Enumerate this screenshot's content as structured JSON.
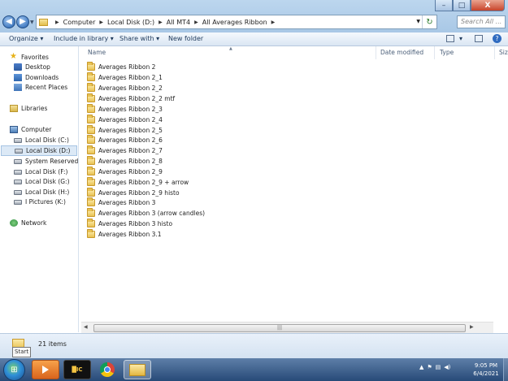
{
  "window": {
    "controls": {
      "minimize": "–",
      "maximize": "□",
      "close": "X"
    }
  },
  "nav": {
    "back_glyph": "◀",
    "forward_glyph": "▶",
    "dropdown_glyph": "▼"
  },
  "address": {
    "segments": [
      "Computer",
      "Local Disk (D:)",
      "All MT4",
      "All  Averages Ribbon"
    ],
    "separator": "▶",
    "dropdown_glyph": "▼",
    "refresh_glyph": "↻"
  },
  "search": {
    "placeholder": "Search All ..."
  },
  "toolbar": {
    "organize": "Organize ▾",
    "include": "Include in library ▾",
    "share": "Share with ▾",
    "new_folder": "New folder",
    "view_dd": "▾",
    "help": "?"
  },
  "sidebar": {
    "favorites": {
      "label": "Favorites",
      "items": [
        {
          "label": "Desktop",
          "icon": "desktop-icon"
        },
        {
          "label": "Downloads",
          "icon": "downloads-icon"
        },
        {
          "label": "Recent Places",
          "icon": "recent-places-icon"
        }
      ]
    },
    "libraries": {
      "label": "Libraries"
    },
    "computer": {
      "label": "Computer",
      "drives": [
        {
          "label": "Local Disk (C:)",
          "selected": false
        },
        {
          "label": "Local Disk (D:)",
          "selected": true
        },
        {
          "label": "System Reserved (E:)",
          "selected": false
        },
        {
          "label": "Local Disk (F:)",
          "selected": false
        },
        {
          "label": "Local Disk (G:)",
          "selected": false
        },
        {
          "label": "Local Disk (H:)",
          "selected": false
        },
        {
          "label": "I Pictures (K:)",
          "selected": false
        }
      ]
    },
    "network": {
      "label": "Network"
    }
  },
  "columns": {
    "name": "Name",
    "date": "Date modified",
    "type": "Type",
    "size": "Size",
    "sort_glyph": "▲"
  },
  "files": [
    "Averages Ribbon 2",
    "Averages Ribbon 2_1",
    "Averages Ribbon 2_2",
    "Averages Ribbon 2_2 mtf",
    "Averages Ribbon 2_3",
    "Averages Ribbon 2_4",
    "Averages Ribbon 2_5",
    "Averages Ribbon 2_6",
    "Averages Ribbon 2_7",
    "Averages Ribbon 2_8",
    "Averages Ribbon 2_9",
    "Averages Ribbon 2_9 + arrow",
    "Averages Ribbon 2_9 histo",
    "Averages Ribbon 3",
    "Averages Ribbon 3 (arrow candles)",
    "Averages Ribbon 3 histo",
    "Averages Ribbon 3.1"
  ],
  "hscroll": {
    "left": "◀",
    "right": "▶",
    "grip": "|||"
  },
  "status": {
    "item_count": "21 items",
    "tooltip": "Start"
  },
  "taskbar": {
    "start_glyph": "⊞",
    "mt4_label": "█IC",
    "tray": [
      "▲",
      "⚑",
      "▤",
      "◀)"
    ],
    "time": "9:05 PM",
    "date": "6/4/2021"
  }
}
